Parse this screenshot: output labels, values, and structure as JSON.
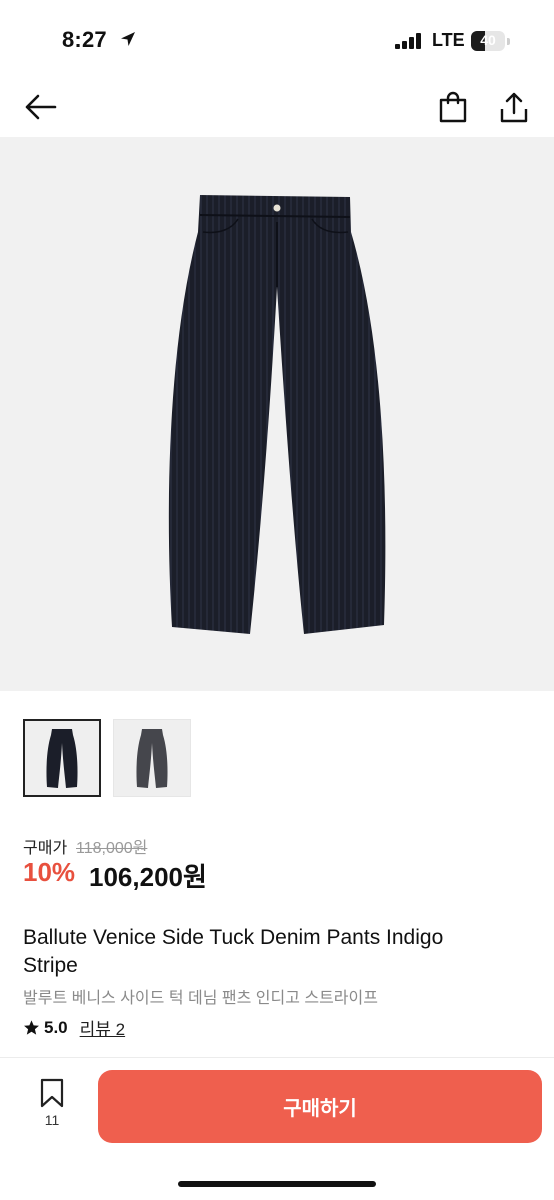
{
  "status_bar": {
    "time": "8:27",
    "network": "LTE",
    "battery": "40",
    "battery_level": 0.4
  },
  "nav": {
    "back_icon": "arrow-left-icon",
    "bag_icon": "shopping-bag-icon",
    "share_icon": "share-icon"
  },
  "gallery": {
    "image_count": 2,
    "selected_index": 0,
    "colors": {
      "pants": "#1b1e29",
      "pants_gray": "#45464c"
    }
  },
  "price": {
    "label": "구매가",
    "original": "118,000원",
    "discount": "10%",
    "final": "106,200원",
    "discount_color": "#e8503e"
  },
  "product": {
    "title_en": "Ballute Venice Side Tuck Denim Pants Indigo Stripe",
    "title_ko": "발루트 베니스 사이드 턱 데님 팬츠 인디고 스트라이프",
    "rating": "5.0",
    "review_label": "리뷰 2"
  },
  "bottom_bar": {
    "wishlist_count": "11",
    "buy_label": "구매하기",
    "accent": "#ef5f4e"
  }
}
